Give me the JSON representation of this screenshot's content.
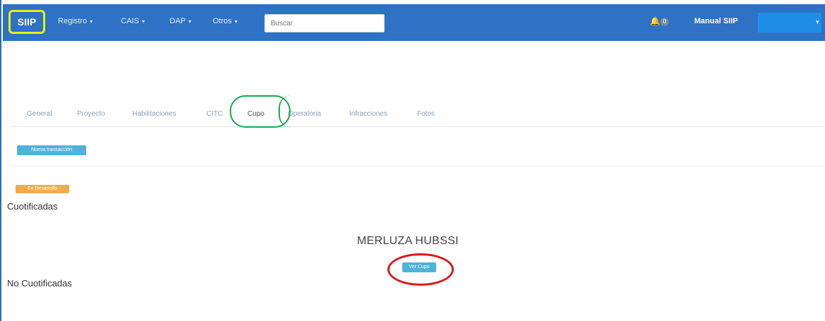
{
  "navbar": {
    "brand": "SIIP",
    "menus": [
      {
        "label": "Registro"
      },
      {
        "label": "CAIS"
      },
      {
        "label": "DAP"
      },
      {
        "label": "Otros"
      }
    ],
    "search_placeholder": "Buscar",
    "notification_count": "0",
    "manual_label": "Manual SIIP",
    "colors": {
      "navbar": "#2d72c4",
      "brand_highlight": "#e8f000"
    }
  },
  "tabs": [
    {
      "label": "General",
      "active": false
    },
    {
      "label": "Proyecto",
      "active": false
    },
    {
      "label": "Habilitaciones",
      "active": false
    },
    {
      "label": "CITC",
      "active": false
    },
    {
      "label": "Cupo",
      "active": true
    },
    {
      "label": "Operatoria",
      "active": false
    },
    {
      "label": "Infracciones",
      "active": false
    },
    {
      "label": "Fotos",
      "active": false
    }
  ],
  "actions": {
    "new_button": "Nueva transacción",
    "view_button": "Ver Cupo"
  },
  "status_badge": "En Desarrollo",
  "sections": {
    "cuotificadas": "Cuotificadas",
    "no_cuotificadas": "No Cuotificadas"
  },
  "product_name": "MERLUZA HUBSSI",
  "annotations": {
    "green_highlight_color": "#1aa84a",
    "red_highlight_color": "#e01616"
  }
}
